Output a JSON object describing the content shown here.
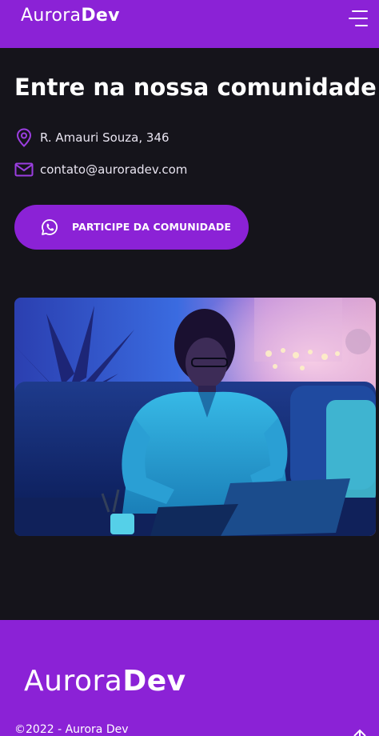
{
  "header": {
    "logo_light": "Aurora",
    "logo_bold": "Dev",
    "menu_icon": "hamburger-menu-icon"
  },
  "main": {
    "title": "Entre na nossa comunidade!",
    "address": "R. Amauri Souza, 346",
    "address_icon": "location-pin-icon",
    "email": "contato@auroradev.com",
    "email_icon": "envelope-icon",
    "cta_label": "PARTICIPE DA COMUNIDADE",
    "cta_icon": "whatsapp-icon"
  },
  "footer": {
    "logo_light": "Aurora",
    "logo_bold": "Dev",
    "copyright": "©2022 - Aurora Dev",
    "back_top_icon": "arrow-up-icon"
  },
  "colors": {
    "brand": "#8b22d6",
    "background": "#15141b",
    "text": "#ffffff"
  }
}
